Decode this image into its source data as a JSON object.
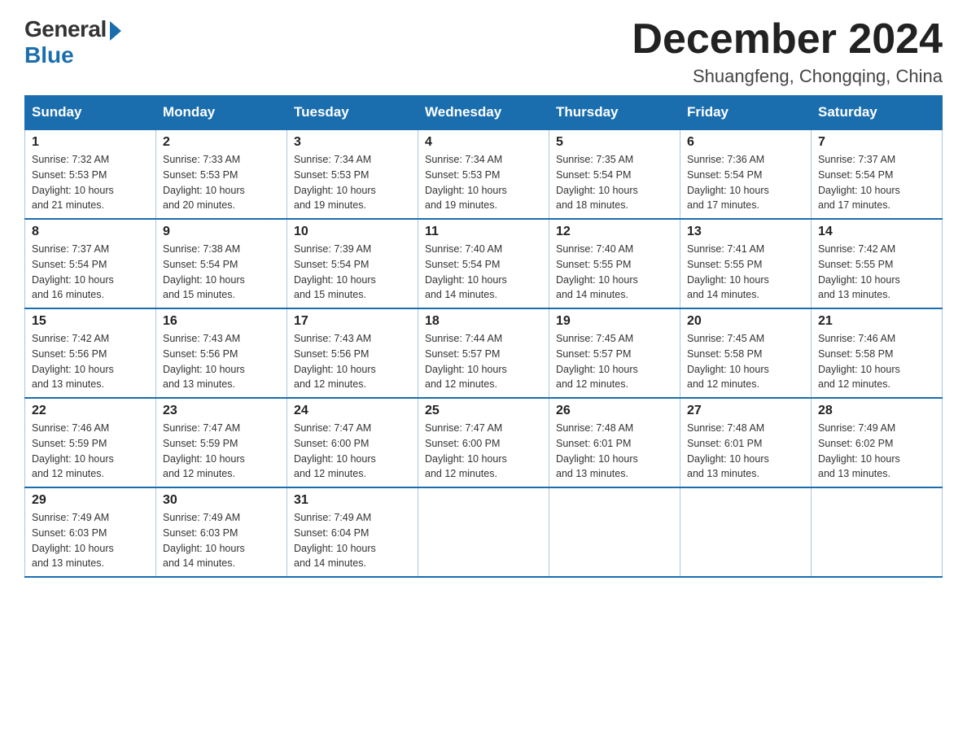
{
  "logo": {
    "general": "General",
    "blue": "Blue"
  },
  "title": "December 2024",
  "subtitle": "Shuangfeng, Chongqing, China",
  "weekdays": [
    "Sunday",
    "Monday",
    "Tuesday",
    "Wednesday",
    "Thursday",
    "Friday",
    "Saturday"
  ],
  "weeks": [
    [
      {
        "day": "1",
        "sunrise": "7:32 AM",
        "sunset": "5:53 PM",
        "daylight": "10 hours and 21 minutes."
      },
      {
        "day": "2",
        "sunrise": "7:33 AM",
        "sunset": "5:53 PM",
        "daylight": "10 hours and 20 minutes."
      },
      {
        "day": "3",
        "sunrise": "7:34 AM",
        "sunset": "5:53 PM",
        "daylight": "10 hours and 19 minutes."
      },
      {
        "day": "4",
        "sunrise": "7:34 AM",
        "sunset": "5:53 PM",
        "daylight": "10 hours and 19 minutes."
      },
      {
        "day": "5",
        "sunrise": "7:35 AM",
        "sunset": "5:54 PM",
        "daylight": "10 hours and 18 minutes."
      },
      {
        "day": "6",
        "sunrise": "7:36 AM",
        "sunset": "5:54 PM",
        "daylight": "10 hours and 17 minutes."
      },
      {
        "day": "7",
        "sunrise": "7:37 AM",
        "sunset": "5:54 PM",
        "daylight": "10 hours and 17 minutes."
      }
    ],
    [
      {
        "day": "8",
        "sunrise": "7:37 AM",
        "sunset": "5:54 PM",
        "daylight": "10 hours and 16 minutes."
      },
      {
        "day": "9",
        "sunrise": "7:38 AM",
        "sunset": "5:54 PM",
        "daylight": "10 hours and 15 minutes."
      },
      {
        "day": "10",
        "sunrise": "7:39 AM",
        "sunset": "5:54 PM",
        "daylight": "10 hours and 15 minutes."
      },
      {
        "day": "11",
        "sunrise": "7:40 AM",
        "sunset": "5:54 PM",
        "daylight": "10 hours and 14 minutes."
      },
      {
        "day": "12",
        "sunrise": "7:40 AM",
        "sunset": "5:55 PM",
        "daylight": "10 hours and 14 minutes."
      },
      {
        "day": "13",
        "sunrise": "7:41 AM",
        "sunset": "5:55 PM",
        "daylight": "10 hours and 14 minutes."
      },
      {
        "day": "14",
        "sunrise": "7:42 AM",
        "sunset": "5:55 PM",
        "daylight": "10 hours and 13 minutes."
      }
    ],
    [
      {
        "day": "15",
        "sunrise": "7:42 AM",
        "sunset": "5:56 PM",
        "daylight": "10 hours and 13 minutes."
      },
      {
        "day": "16",
        "sunrise": "7:43 AM",
        "sunset": "5:56 PM",
        "daylight": "10 hours and 13 minutes."
      },
      {
        "day": "17",
        "sunrise": "7:43 AM",
        "sunset": "5:56 PM",
        "daylight": "10 hours and 12 minutes."
      },
      {
        "day": "18",
        "sunrise": "7:44 AM",
        "sunset": "5:57 PM",
        "daylight": "10 hours and 12 minutes."
      },
      {
        "day": "19",
        "sunrise": "7:45 AM",
        "sunset": "5:57 PM",
        "daylight": "10 hours and 12 minutes."
      },
      {
        "day": "20",
        "sunrise": "7:45 AM",
        "sunset": "5:58 PM",
        "daylight": "10 hours and 12 minutes."
      },
      {
        "day": "21",
        "sunrise": "7:46 AM",
        "sunset": "5:58 PM",
        "daylight": "10 hours and 12 minutes."
      }
    ],
    [
      {
        "day": "22",
        "sunrise": "7:46 AM",
        "sunset": "5:59 PM",
        "daylight": "10 hours and 12 minutes."
      },
      {
        "day": "23",
        "sunrise": "7:47 AM",
        "sunset": "5:59 PM",
        "daylight": "10 hours and 12 minutes."
      },
      {
        "day": "24",
        "sunrise": "7:47 AM",
        "sunset": "6:00 PM",
        "daylight": "10 hours and 12 minutes."
      },
      {
        "day": "25",
        "sunrise": "7:47 AM",
        "sunset": "6:00 PM",
        "daylight": "10 hours and 12 minutes."
      },
      {
        "day": "26",
        "sunrise": "7:48 AM",
        "sunset": "6:01 PM",
        "daylight": "10 hours and 13 minutes."
      },
      {
        "day": "27",
        "sunrise": "7:48 AM",
        "sunset": "6:01 PM",
        "daylight": "10 hours and 13 minutes."
      },
      {
        "day": "28",
        "sunrise": "7:49 AM",
        "sunset": "6:02 PM",
        "daylight": "10 hours and 13 minutes."
      }
    ],
    [
      {
        "day": "29",
        "sunrise": "7:49 AM",
        "sunset": "6:03 PM",
        "daylight": "10 hours and 13 minutes."
      },
      {
        "day": "30",
        "sunrise": "7:49 AM",
        "sunset": "6:03 PM",
        "daylight": "10 hours and 14 minutes."
      },
      {
        "day": "31",
        "sunrise": "7:49 AM",
        "sunset": "6:04 PM",
        "daylight": "10 hours and 14 minutes."
      },
      null,
      null,
      null,
      null
    ]
  ],
  "labels": {
    "sunrise": "Sunrise:",
    "sunset": "Sunset:",
    "daylight": "Daylight:"
  }
}
